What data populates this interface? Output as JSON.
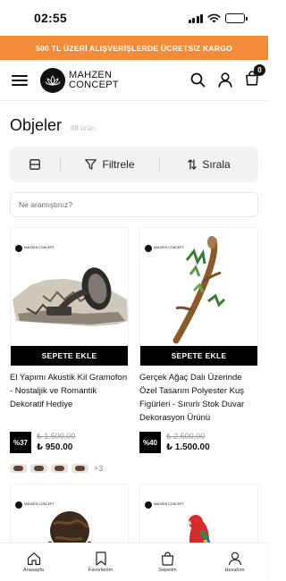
{
  "status_bar": {
    "time": "02:55"
  },
  "promo_banner": {
    "text": "500 TL ÜZERİ ALIŞVERİŞLERDE ÜCRETSİZ KARGO"
  },
  "header": {
    "logo_line1": "MAHZEN",
    "logo_line2": "CONCEPT",
    "cart_count": "0",
    "icons": [
      "menu-icon",
      "search-icon",
      "user-icon",
      "cart-icon"
    ]
  },
  "page": {
    "title": "Objeler",
    "product_count": "88 ürün"
  },
  "toolbar": {
    "filter_label": "Filtrele",
    "sort_label": "Sırala"
  },
  "search": {
    "placeholder": "Ne aramıştınız?"
  },
  "products": [
    {
      "name": "El Yapımı Akustik Kil Gramofon - Nostaljik ve Romantik Dekoratif Hediye",
      "discount": "%37",
      "old_price": "₺ 1.500,00",
      "new_price": "₺ 950.00",
      "button_label": "SEPETE EKLE",
      "mini_logo": "MAHZEN CONCEPT",
      "more_variants": "+3"
    },
    {
      "name": "Gerçek Ağaç Dalı Üzerinde Özel Tasarım Polyester Kuş Figürleri - Sınırlı Stok Duvar Dekorasyon Ürünü",
      "discount": "%40",
      "old_price": "₺ 2.500,00",
      "new_price": "₺ 1.500.00",
      "button_label": "SEPETE EKLE",
      "mini_logo": "MAHZEN CONCEPT"
    },
    {
      "mini_logo": "MAHZEN CONCEPT"
    },
    {
      "mini_logo": "MAHZEN CONCEPT"
    }
  ],
  "bottom_nav": [
    {
      "label": "Anasayfa",
      "icon": "home-icon"
    },
    {
      "label": "Favorilerim",
      "icon": "bookmark-icon"
    },
    {
      "label": "Sepetim",
      "icon": "bag-icon"
    },
    {
      "label": "Hesabım",
      "icon": "user-icon"
    }
  ],
  "colors": {
    "promo_bg": "#f28b3a",
    "button_bg": "#000000",
    "toolbar_bg": "#f2f2f2"
  }
}
